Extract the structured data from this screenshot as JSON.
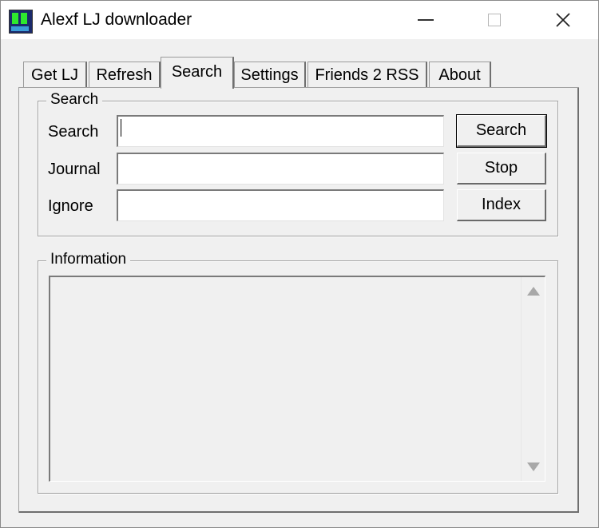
{
  "window": {
    "title": "Alexf LJ downloader"
  },
  "tabs": [
    {
      "label": "Get LJ"
    },
    {
      "label": "Refresh"
    },
    {
      "label": "Search"
    },
    {
      "label": "Settings"
    },
    {
      "label": "Friends 2 RSS"
    },
    {
      "label": "About"
    }
  ],
  "active_tab": "Search",
  "search_group": {
    "title": "Search",
    "fields": {
      "search": {
        "label": "Search",
        "value": ""
      },
      "journal": {
        "label": "Journal",
        "value": ""
      },
      "ignore": {
        "label": "Ignore",
        "value": ""
      }
    },
    "buttons": {
      "search": "Search",
      "stop": "Stop",
      "index": "Index"
    }
  },
  "info_group": {
    "title": "Information",
    "text": ""
  },
  "icons": {
    "app": "app-icon",
    "minimize": "minimize-icon",
    "maximize": "maximize-icon",
    "close": "close-icon",
    "scroll_up": "arrow-up-icon",
    "scroll_down": "arrow-down-icon"
  }
}
